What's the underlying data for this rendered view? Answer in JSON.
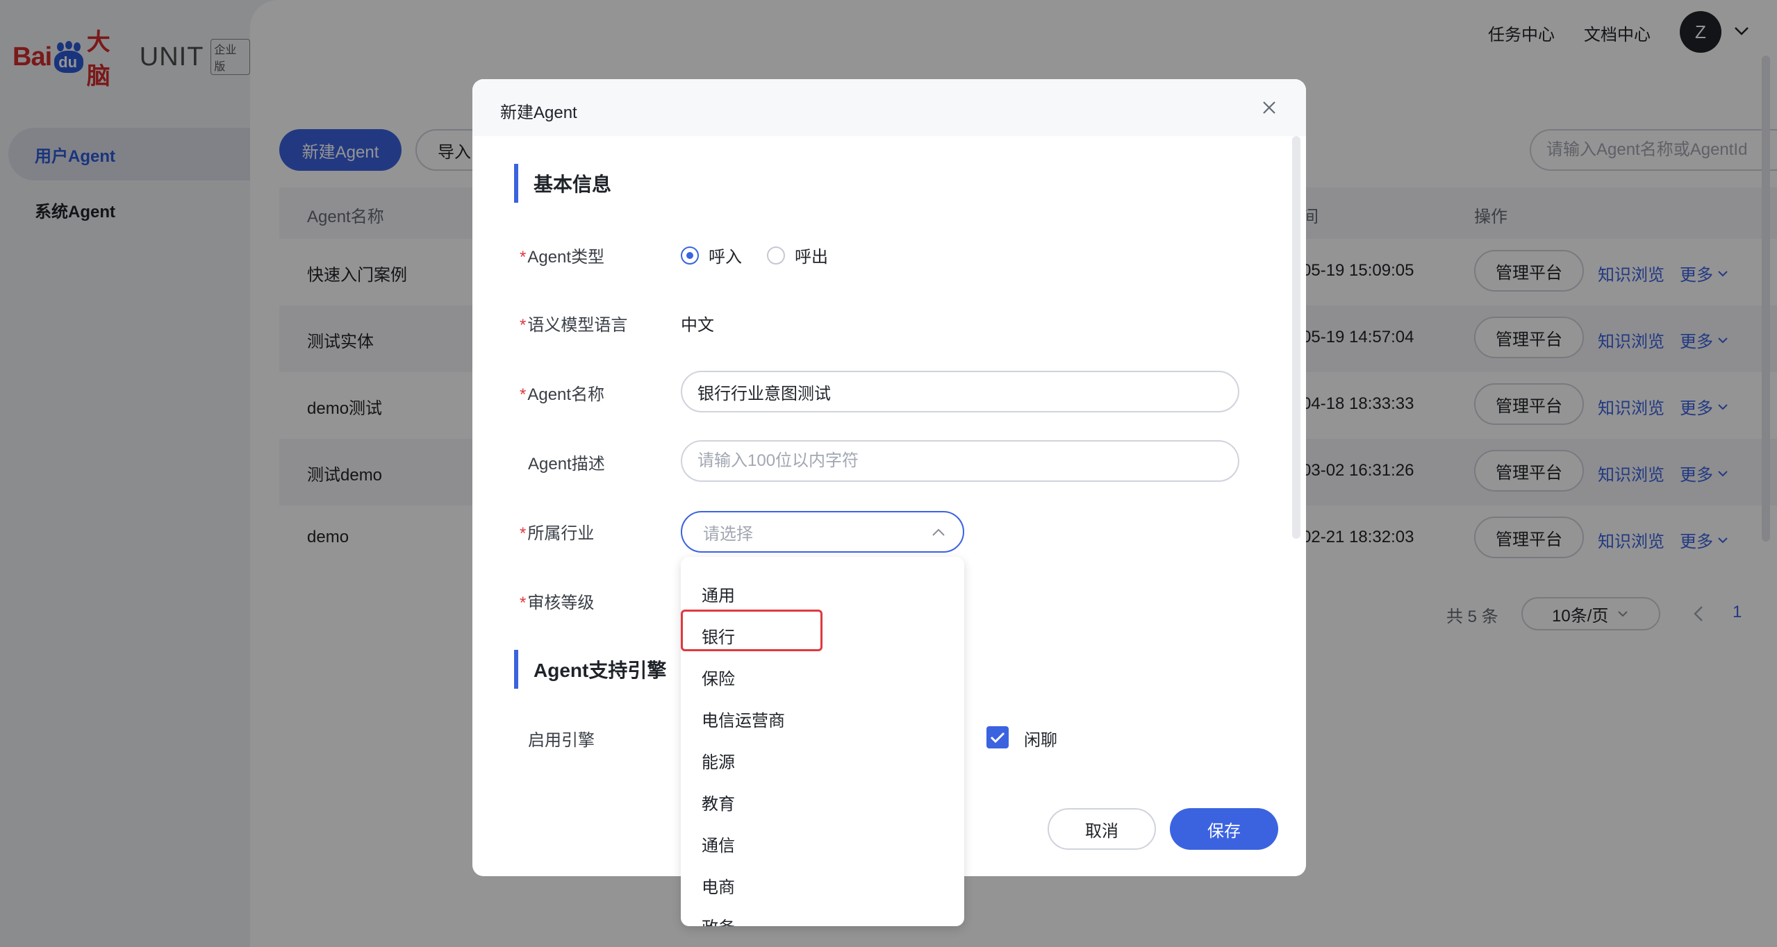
{
  "sidebar": {
    "logo": {
      "bai": "Bai",
      "du": "du",
      "danao": "大脑",
      "unit": "UNIT",
      "badge": "企业版"
    },
    "items": [
      {
        "label": "用户Agent",
        "active": true
      },
      {
        "label": "系统Agent",
        "active": false
      }
    ]
  },
  "topbar": {
    "links": [
      "任务中心",
      "文档中心"
    ],
    "avatar_letter": "Z"
  },
  "toolbar": {
    "new_agent_label": "新建Agent",
    "import_label": "导入",
    "search_placeholder": "请输入Agent名称或AgentId"
  },
  "table": {
    "headers": {
      "name": "Agent名称",
      "time": "间",
      "ops": "操作"
    },
    "rows": [
      {
        "name": "快速入门案例",
        "time": "05-19 15:09:05"
      },
      {
        "name": "测试实体",
        "time": "05-19 14:57:04"
      },
      {
        "name": "demo测试",
        "time": "04-18 18:33:33"
      },
      {
        "name": "测试demo",
        "time": "03-02 16:31:26"
      },
      {
        "name": "demo",
        "time": "02-21 18:32:03"
      }
    ],
    "manage_label": "管理平台",
    "knowledge_label": "知识浏览",
    "more_label": "更多"
  },
  "pagination": {
    "total": "共 5 条",
    "page_size": "10条/页",
    "current_page": "1"
  },
  "modal": {
    "title": "新建Agent",
    "section_basic": "基本信息",
    "section_engine": "Agent支持引擎",
    "fields": {
      "agent_type": "Agent类型",
      "language": "语义模型语言",
      "agent_name": "Agent名称",
      "agent_desc": "Agent描述",
      "industry": "所属行业",
      "review_level": "审核等级",
      "enable_engine": "启用引擎"
    },
    "radio_in": "呼入",
    "radio_out": "呼出",
    "language_value": "中文",
    "agent_name_value": "银行行业意图测试",
    "agent_desc_placeholder": "请输入100位以内字符",
    "industry_placeholder": "请选择",
    "chitchat_label": "闲聊",
    "cancel_label": "取消",
    "save_label": "保存"
  },
  "dropdown": {
    "options": [
      "通用",
      "银行",
      "保险",
      "电信运营商",
      "能源",
      "教育",
      "通信",
      "电商",
      "政务"
    ]
  },
  "colors": {
    "accent": "#3b63e0",
    "required": "#e0393e",
    "highlight": "#e0393e"
  }
}
